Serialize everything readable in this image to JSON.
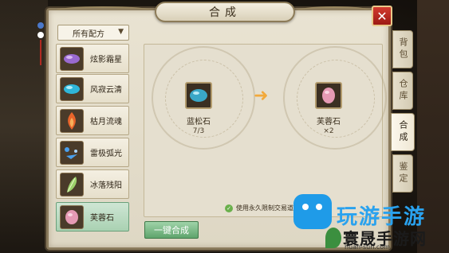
{
  "window": {
    "title": "合成",
    "close_label": "✕"
  },
  "filter": {
    "selected": "所有配方"
  },
  "recipes": [
    {
      "name": "炫影霜星",
      "icon": "purple-crystal-icon",
      "color": "#9a6ad0"
    },
    {
      "name": "风寂云清",
      "icon": "cyan-gem-icon",
      "color": "#2fb6d9"
    },
    {
      "name": "枯月流魂",
      "icon": "orange-flame-icon",
      "color": "#e8642a"
    },
    {
      "name": "雷极弧光",
      "icon": "blue-lightning-icon",
      "color": "#4aa0ee"
    },
    {
      "name": "冰落残阳",
      "icon": "green-feather-icon",
      "color": "#9ccf6a"
    },
    {
      "name": "芙蓉石",
      "icon": "pink-stone-icon",
      "color": "#e59ab4",
      "selected": true
    }
  ],
  "material": {
    "name": "蓝松石",
    "count": "7/3",
    "icon": "turquoise-stone-icon",
    "color": "#3aa7c7"
  },
  "result": {
    "name": "芙蓉石",
    "count": "×2",
    "icon": "pink-stone-icon",
    "color": "#e59ab4"
  },
  "option": {
    "label": "使用永久限制交易道具",
    "checked": true
  },
  "actions": {
    "one_click": "一键合成"
  },
  "tabs": [
    {
      "label": "背包",
      "active": false
    },
    {
      "label": "仓库",
      "active": false
    },
    {
      "label": "合成",
      "active": true
    },
    {
      "label": "鉴定",
      "active": false
    }
  ],
  "watermark": {
    "brand": "玩游手游",
    "site_cn": "寰晟手游网",
    "url": "huan-sun.com"
  },
  "colors": {
    "accent_green": "#5fa46c",
    "close_red": "#c0281e"
  }
}
